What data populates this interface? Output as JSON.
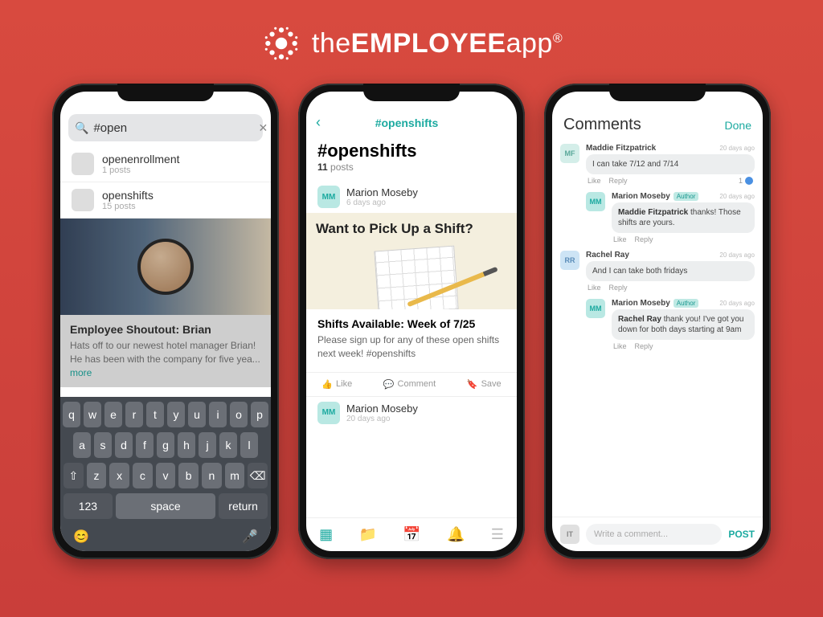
{
  "brand": {
    "text_thin": "the",
    "text_bold": "EMPLOYEE",
    "text_thin2": "app",
    "reg": "®"
  },
  "phone1": {
    "search_value": "#open",
    "suggestions": [
      {
        "tag": "openenrollment",
        "count": "1 posts"
      },
      {
        "tag": "openshifts",
        "count": "15 posts"
      }
    ],
    "card": {
      "title": "Employee Shoutout: Brian",
      "desc": "Hats off to our newest hotel manager Brian! He has been with the company for five yea...",
      "more": "more"
    },
    "keyboard": {
      "row1": [
        "q",
        "w",
        "e",
        "r",
        "t",
        "y",
        "u",
        "i",
        "o",
        "p"
      ],
      "row2": [
        "a",
        "s",
        "d",
        "f",
        "g",
        "h",
        "j",
        "k",
        "l"
      ],
      "row3_shift": "⇧",
      "row3": [
        "z",
        "x",
        "c",
        "v",
        "b",
        "n",
        "m"
      ],
      "row3_del": "⌫",
      "num": "123",
      "space": "space",
      "return": "return"
    }
  },
  "phone2": {
    "nav_title": "#openshifts",
    "header": "#openshifts",
    "count": "11",
    "count_label": "posts",
    "posts": [
      {
        "initials": "MM",
        "name": "Marion Moseby",
        "time": "6 days ago"
      },
      {
        "initials": "MM",
        "name": "Marion Moseby",
        "time": "20 days ago"
      }
    ],
    "shift_banner": "Want to Pick Up a Shift?",
    "post_title": "Shifts Available: Week of 7/25",
    "post_desc": "Please sign up for any of these open shifts next week! #openshifts",
    "actions": {
      "like": "Like",
      "comment": "Comment",
      "save": "Save"
    }
  },
  "phone3": {
    "title": "Comments",
    "done": "Done",
    "comments": [
      {
        "av": "MF",
        "cls": "mf",
        "name": "Maddie Fitzpatrick",
        "time": "20 days ago",
        "text": "I can take 7/12 and 7/14",
        "count": "1"
      },
      {
        "av": "MM",
        "cls": "mm",
        "name": "Marion Moseby",
        "badge": "Author",
        "time": "20 days ago",
        "mention": "Maddie Fitzpatrick",
        "text": " thanks! Those shifts are yours.",
        "nested": true
      },
      {
        "av": "RR",
        "cls": "rr",
        "name": "Rachel Ray",
        "time": "20 days ago",
        "text": "And I can take both fridays"
      },
      {
        "av": "MM",
        "cls": "mm",
        "name": "Marion Moseby",
        "badge": "Author",
        "time": "20 days ago",
        "mention": "Rachel Ray",
        "text": " thank you! I've got you down for both days starting at 9am",
        "nested": true
      }
    ],
    "like": "Like",
    "reply": "Reply",
    "compose": {
      "av": "IT",
      "placeholder": "Write a comment...",
      "post": "POST"
    }
  }
}
